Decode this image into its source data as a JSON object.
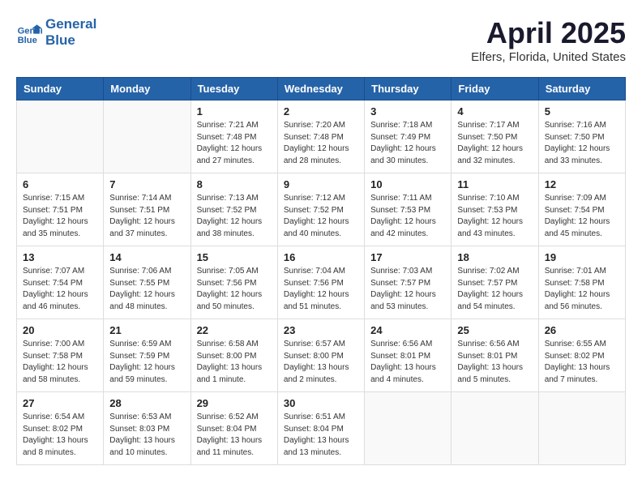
{
  "header": {
    "logo_line1": "General",
    "logo_line2": "Blue",
    "month_title": "April 2025",
    "location": "Elfers, Florida, United States"
  },
  "weekdays": [
    "Sunday",
    "Monday",
    "Tuesday",
    "Wednesday",
    "Thursday",
    "Friday",
    "Saturday"
  ],
  "weeks": [
    [
      {
        "day": "",
        "info": ""
      },
      {
        "day": "",
        "info": ""
      },
      {
        "day": "1",
        "info": "Sunrise: 7:21 AM\nSunset: 7:48 PM\nDaylight: 12 hours\nand 27 minutes."
      },
      {
        "day": "2",
        "info": "Sunrise: 7:20 AM\nSunset: 7:48 PM\nDaylight: 12 hours\nand 28 minutes."
      },
      {
        "day": "3",
        "info": "Sunrise: 7:18 AM\nSunset: 7:49 PM\nDaylight: 12 hours\nand 30 minutes."
      },
      {
        "day": "4",
        "info": "Sunrise: 7:17 AM\nSunset: 7:50 PM\nDaylight: 12 hours\nand 32 minutes."
      },
      {
        "day": "5",
        "info": "Sunrise: 7:16 AM\nSunset: 7:50 PM\nDaylight: 12 hours\nand 33 minutes."
      }
    ],
    [
      {
        "day": "6",
        "info": "Sunrise: 7:15 AM\nSunset: 7:51 PM\nDaylight: 12 hours\nand 35 minutes."
      },
      {
        "day": "7",
        "info": "Sunrise: 7:14 AM\nSunset: 7:51 PM\nDaylight: 12 hours\nand 37 minutes."
      },
      {
        "day": "8",
        "info": "Sunrise: 7:13 AM\nSunset: 7:52 PM\nDaylight: 12 hours\nand 38 minutes."
      },
      {
        "day": "9",
        "info": "Sunrise: 7:12 AM\nSunset: 7:52 PM\nDaylight: 12 hours\nand 40 minutes."
      },
      {
        "day": "10",
        "info": "Sunrise: 7:11 AM\nSunset: 7:53 PM\nDaylight: 12 hours\nand 42 minutes."
      },
      {
        "day": "11",
        "info": "Sunrise: 7:10 AM\nSunset: 7:53 PM\nDaylight: 12 hours\nand 43 minutes."
      },
      {
        "day": "12",
        "info": "Sunrise: 7:09 AM\nSunset: 7:54 PM\nDaylight: 12 hours\nand 45 minutes."
      }
    ],
    [
      {
        "day": "13",
        "info": "Sunrise: 7:07 AM\nSunset: 7:54 PM\nDaylight: 12 hours\nand 46 minutes."
      },
      {
        "day": "14",
        "info": "Sunrise: 7:06 AM\nSunset: 7:55 PM\nDaylight: 12 hours\nand 48 minutes."
      },
      {
        "day": "15",
        "info": "Sunrise: 7:05 AM\nSunset: 7:56 PM\nDaylight: 12 hours\nand 50 minutes."
      },
      {
        "day": "16",
        "info": "Sunrise: 7:04 AM\nSunset: 7:56 PM\nDaylight: 12 hours\nand 51 minutes."
      },
      {
        "day": "17",
        "info": "Sunrise: 7:03 AM\nSunset: 7:57 PM\nDaylight: 12 hours\nand 53 minutes."
      },
      {
        "day": "18",
        "info": "Sunrise: 7:02 AM\nSunset: 7:57 PM\nDaylight: 12 hours\nand 54 minutes."
      },
      {
        "day": "19",
        "info": "Sunrise: 7:01 AM\nSunset: 7:58 PM\nDaylight: 12 hours\nand 56 minutes."
      }
    ],
    [
      {
        "day": "20",
        "info": "Sunrise: 7:00 AM\nSunset: 7:58 PM\nDaylight: 12 hours\nand 58 minutes."
      },
      {
        "day": "21",
        "info": "Sunrise: 6:59 AM\nSunset: 7:59 PM\nDaylight: 12 hours\nand 59 minutes."
      },
      {
        "day": "22",
        "info": "Sunrise: 6:58 AM\nSunset: 8:00 PM\nDaylight: 13 hours\nand 1 minute."
      },
      {
        "day": "23",
        "info": "Sunrise: 6:57 AM\nSunset: 8:00 PM\nDaylight: 13 hours\nand 2 minutes."
      },
      {
        "day": "24",
        "info": "Sunrise: 6:56 AM\nSunset: 8:01 PM\nDaylight: 13 hours\nand 4 minutes."
      },
      {
        "day": "25",
        "info": "Sunrise: 6:56 AM\nSunset: 8:01 PM\nDaylight: 13 hours\nand 5 minutes."
      },
      {
        "day": "26",
        "info": "Sunrise: 6:55 AM\nSunset: 8:02 PM\nDaylight: 13 hours\nand 7 minutes."
      }
    ],
    [
      {
        "day": "27",
        "info": "Sunrise: 6:54 AM\nSunset: 8:02 PM\nDaylight: 13 hours\nand 8 minutes."
      },
      {
        "day": "28",
        "info": "Sunrise: 6:53 AM\nSunset: 8:03 PM\nDaylight: 13 hours\nand 10 minutes."
      },
      {
        "day": "29",
        "info": "Sunrise: 6:52 AM\nSunset: 8:04 PM\nDaylight: 13 hours\nand 11 minutes."
      },
      {
        "day": "30",
        "info": "Sunrise: 6:51 AM\nSunset: 8:04 PM\nDaylight: 13 hours\nand 13 minutes."
      },
      {
        "day": "",
        "info": ""
      },
      {
        "day": "",
        "info": ""
      },
      {
        "day": "",
        "info": ""
      }
    ]
  ]
}
